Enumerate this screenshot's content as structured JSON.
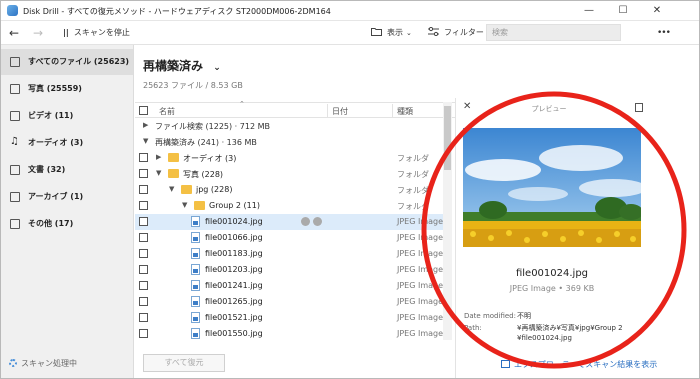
{
  "window": {
    "title": "Disk Drill - すべての復元メソッド - ハードウェアディスク ST2000DM006-2DM164",
    "minimize_glyph": "—",
    "maximize_glyph": "☐",
    "close_glyph": "✕"
  },
  "toolbar": {
    "back_glyph": "←",
    "forward_glyph": "→",
    "pause_label": "スキャンを停止",
    "view_label": "表示",
    "filter_label": "フィルター",
    "search_placeholder": "検索",
    "more_glyph": "•••"
  },
  "sidebar": {
    "items": [
      {
        "label": "すべてのファイル (25623)",
        "icon": "all-files-icon"
      },
      {
        "label": "写真 (25559)",
        "icon": "photo-icon"
      },
      {
        "label": "ビデオ (11)",
        "icon": "video-icon"
      },
      {
        "label": "オーディオ (3)",
        "icon": "audio-icon"
      },
      {
        "label": "文書 (32)",
        "icon": "document-icon"
      },
      {
        "label": "アーカイブ (1)",
        "icon": "archive-icon"
      },
      {
        "label": "その他 (17)",
        "icon": "other-icon"
      }
    ],
    "scan_status": "スキャン処理中"
  },
  "main": {
    "title": "再構築済み",
    "subtitle": "25623 ファイル / 8.53 GB",
    "columns": {
      "name": "名前",
      "date": "日付",
      "type": "種類"
    },
    "rows": [
      {
        "name": "ファイル検索 (1225) · 712 MB",
        "type": "",
        "level": 0,
        "kind": "group",
        "expanded": false,
        "checkbox": false
      },
      {
        "name": "再構築済み (241) · 136 MB",
        "type": "",
        "level": 0,
        "kind": "group",
        "expanded": true,
        "checkbox": false
      },
      {
        "name": "オーディオ (3)",
        "type": "フォルダ",
        "level": 1,
        "kind": "folder",
        "expanded": false,
        "checkbox": true
      },
      {
        "name": "写真 (228)",
        "type": "フォルダ",
        "level": 1,
        "kind": "folder",
        "expanded": true,
        "checkbox": true
      },
      {
        "name": "jpg (228)",
        "type": "フォルダ",
        "level": 2,
        "kind": "folder",
        "expanded": true,
        "checkbox": true
      },
      {
        "name": "Group 2 (11)",
        "type": "フォルダ",
        "level": 3,
        "kind": "folder",
        "expanded": true,
        "checkbox": true
      },
      {
        "name": "file001024.jpg",
        "type": "JPEG Image",
        "level": 4,
        "kind": "file",
        "selected": true,
        "checkbox": true
      },
      {
        "name": "file001066.jpg",
        "type": "JPEG Image",
        "level": 4,
        "kind": "file",
        "checkbox": true
      },
      {
        "name": "file001183.jpg",
        "type": "JPEG Image",
        "level": 4,
        "kind": "file",
        "checkbox": true
      },
      {
        "name": "file001203.jpg",
        "type": "JPEG Image",
        "level": 4,
        "kind": "file",
        "checkbox": true
      },
      {
        "name": "file001241.jpg",
        "type": "JPEG Image",
        "level": 4,
        "kind": "file",
        "checkbox": true
      },
      {
        "name": "file001265.jpg",
        "type": "JPEG Image",
        "level": 4,
        "kind": "file",
        "checkbox": true
      },
      {
        "name": "file001521.jpg",
        "type": "JPEG Image",
        "level": 4,
        "kind": "file",
        "checkbox": true
      },
      {
        "name": "file001550.jpg",
        "type": "JPEG Image",
        "level": 4,
        "kind": "file",
        "checkbox": true
      }
    ],
    "recover_button": "すべて復元"
  },
  "preview": {
    "label": "プレビュー",
    "close_glyph": "✕",
    "file_name": "file001024.jpg",
    "file_meta": "JPEG Image • 369 KB",
    "date_modified_key": "Date modified:",
    "date_modified_value": "不明",
    "path_key": "Path:",
    "path_value_line1": "¥再構築済み¥写真¥jpg¥Group 2",
    "path_value_line2": "¥file001024.jpg",
    "explorer_link": "エクスプローラーでスキャン結果を表示"
  },
  "colors": {
    "accent": "#2a6fc1",
    "annotation": "#e8231a",
    "selection": "#dcebfa",
    "folder": "#f4c044"
  }
}
